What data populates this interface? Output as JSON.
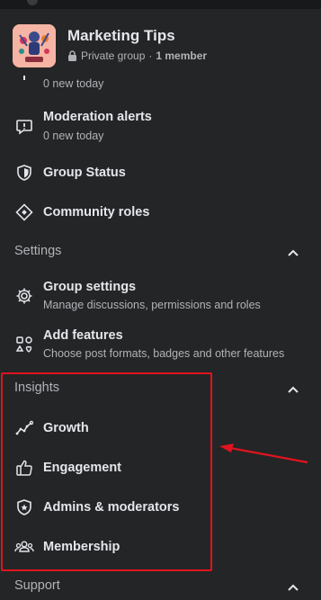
{
  "group": {
    "name": "Marketing Tips",
    "privacy": "Private group",
    "separator": "·",
    "members": "1 member"
  },
  "items": {
    "partial_sub": "0 new today",
    "moderation_alerts": {
      "title": "Moderation alerts",
      "sub": "0 new today"
    },
    "group_status": {
      "title": "Group Status"
    },
    "community_roles": {
      "title": "Community roles"
    },
    "group_settings": {
      "title": "Group settings",
      "sub": "Manage discussions, permissions and roles"
    },
    "add_features": {
      "title": "Add features",
      "sub": "Choose post formats, badges and other features"
    },
    "growth": {
      "title": "Growth"
    },
    "engagement": {
      "title": "Engagement"
    },
    "admins_moderators": {
      "title": "Admins & moderators"
    },
    "membership": {
      "title": "Membership"
    }
  },
  "sections": {
    "settings": "Settings",
    "insights": "Insights",
    "support": "Support"
  },
  "colors": {
    "background": "#242526",
    "primary_text": "#e4e6eb",
    "secondary_text": "#b0b3b8",
    "annotation_red": "#e0141e"
  },
  "icons": {
    "lock": "lock-icon",
    "moderation_alerts": "alert-bubble-icon",
    "group_status": "shield-icon",
    "community_roles": "diamond-icon",
    "group_settings": "gear-icon",
    "add_features": "shapes-icon",
    "growth": "trend-line-icon",
    "engagement": "thumbs-up-icon",
    "admins_moderators": "shield-star-icon",
    "membership": "people-icon",
    "collapse": "chevron-up-icon"
  }
}
